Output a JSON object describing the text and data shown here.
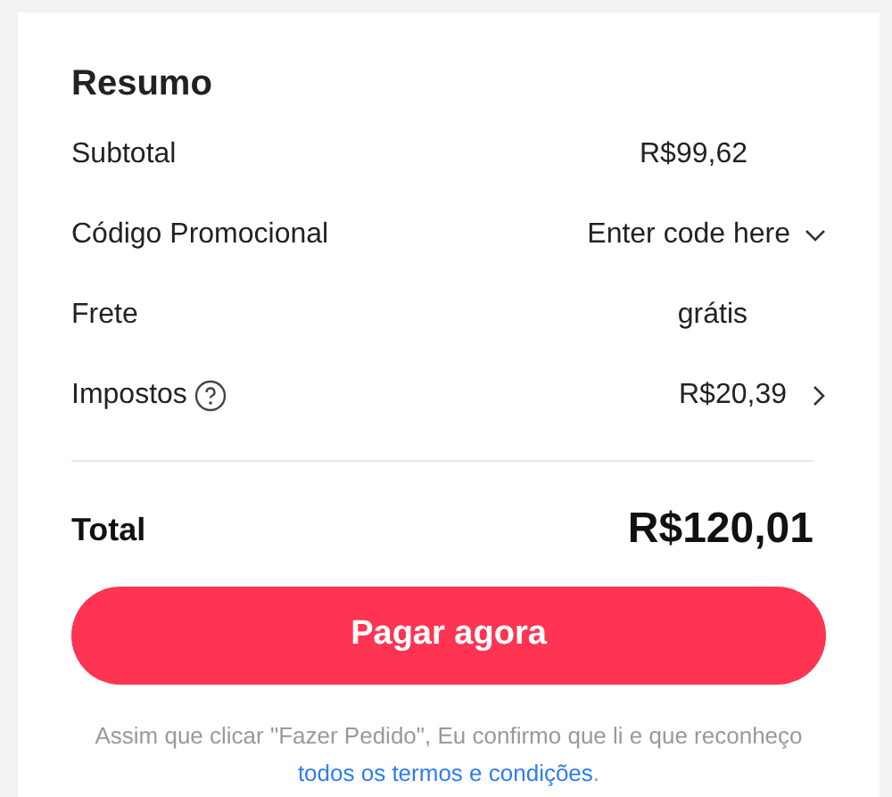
{
  "summary": {
    "title": "Resumo",
    "rows": [
      {
        "kind": "plain",
        "label": "Subtotal",
        "value": "R$99,62"
      },
      {
        "kind": "promo",
        "label": "Código Promocional",
        "value": "Enter code here"
      },
      {
        "kind": "plain",
        "label": "Frete",
        "value": "grátis"
      },
      {
        "kind": "tax",
        "label": "Impostos",
        "value": "R$20,39"
      }
    ],
    "total": {
      "label": "Total",
      "value": "R$120,01"
    },
    "pay_button": "Pagar agora",
    "notice": {
      "text": "Assim que clicar \"Fazer Pedido\", Eu confirmo que li e que reconheço ",
      "link": "todos os termos e condições",
      "after": "."
    }
  }
}
